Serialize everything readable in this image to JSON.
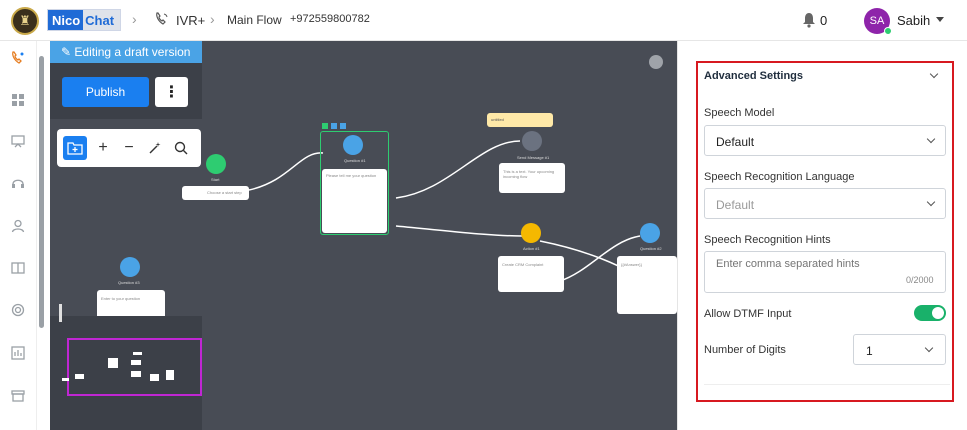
{
  "header": {
    "brand_a": "Nico",
    "brand_b": "Chat",
    "crumb_app": "IVR+",
    "crumb_flow": "Main Flow",
    "crumb_phone": "+972559800782",
    "notification_count": "0",
    "user_initials": "SA",
    "user_name": "Sabih"
  },
  "canvas": {
    "draft_banner": "Editing a draft version",
    "publish_label": "Publish",
    "more_label": "⋮",
    "nodes": [
      {
        "title": "Start",
        "body": "Choose a start step",
        "color": "#2ecc71"
      },
      {
        "title": "Question #1",
        "body": "Please tell me your question",
        "color": "#4aa3e6"
      },
      {
        "title": "Send Message #1",
        "body": "This is a text. Your upcoming incoming flow",
        "color": "#6b7280"
      },
      {
        "title": "Action #1",
        "body": "Create CRM Complaint",
        "color": "#f5b800"
      },
      {
        "title": "Question #2",
        "body": "{{#Answer}}",
        "color": "#4aa3e6"
      },
      {
        "title": "Question #3",
        "body": "Enter to your question",
        "color": "#4aa3e6"
      }
    ],
    "note_label": "untitled"
  },
  "settings": {
    "section_title": "Advanced Settings",
    "speech_model_label": "Speech Model",
    "speech_model_value": "Default",
    "speech_lang_label": "Speech Recognition Language",
    "speech_lang_value": "Default",
    "hints_label": "Speech Recognition Hints",
    "hints_placeholder": "Enter comma separated hints",
    "hints_counter": "0/2000",
    "dtmf_label": "Allow DTMF Input",
    "dtmf_enabled": true,
    "digits_label": "Number of Digits",
    "digits_value": "1"
  },
  "colors": {
    "accent": "#1a7ff0",
    "highlight_border": "#d71920",
    "toggle_on": "#19b16a",
    "canvas_bg": "#484c55"
  }
}
